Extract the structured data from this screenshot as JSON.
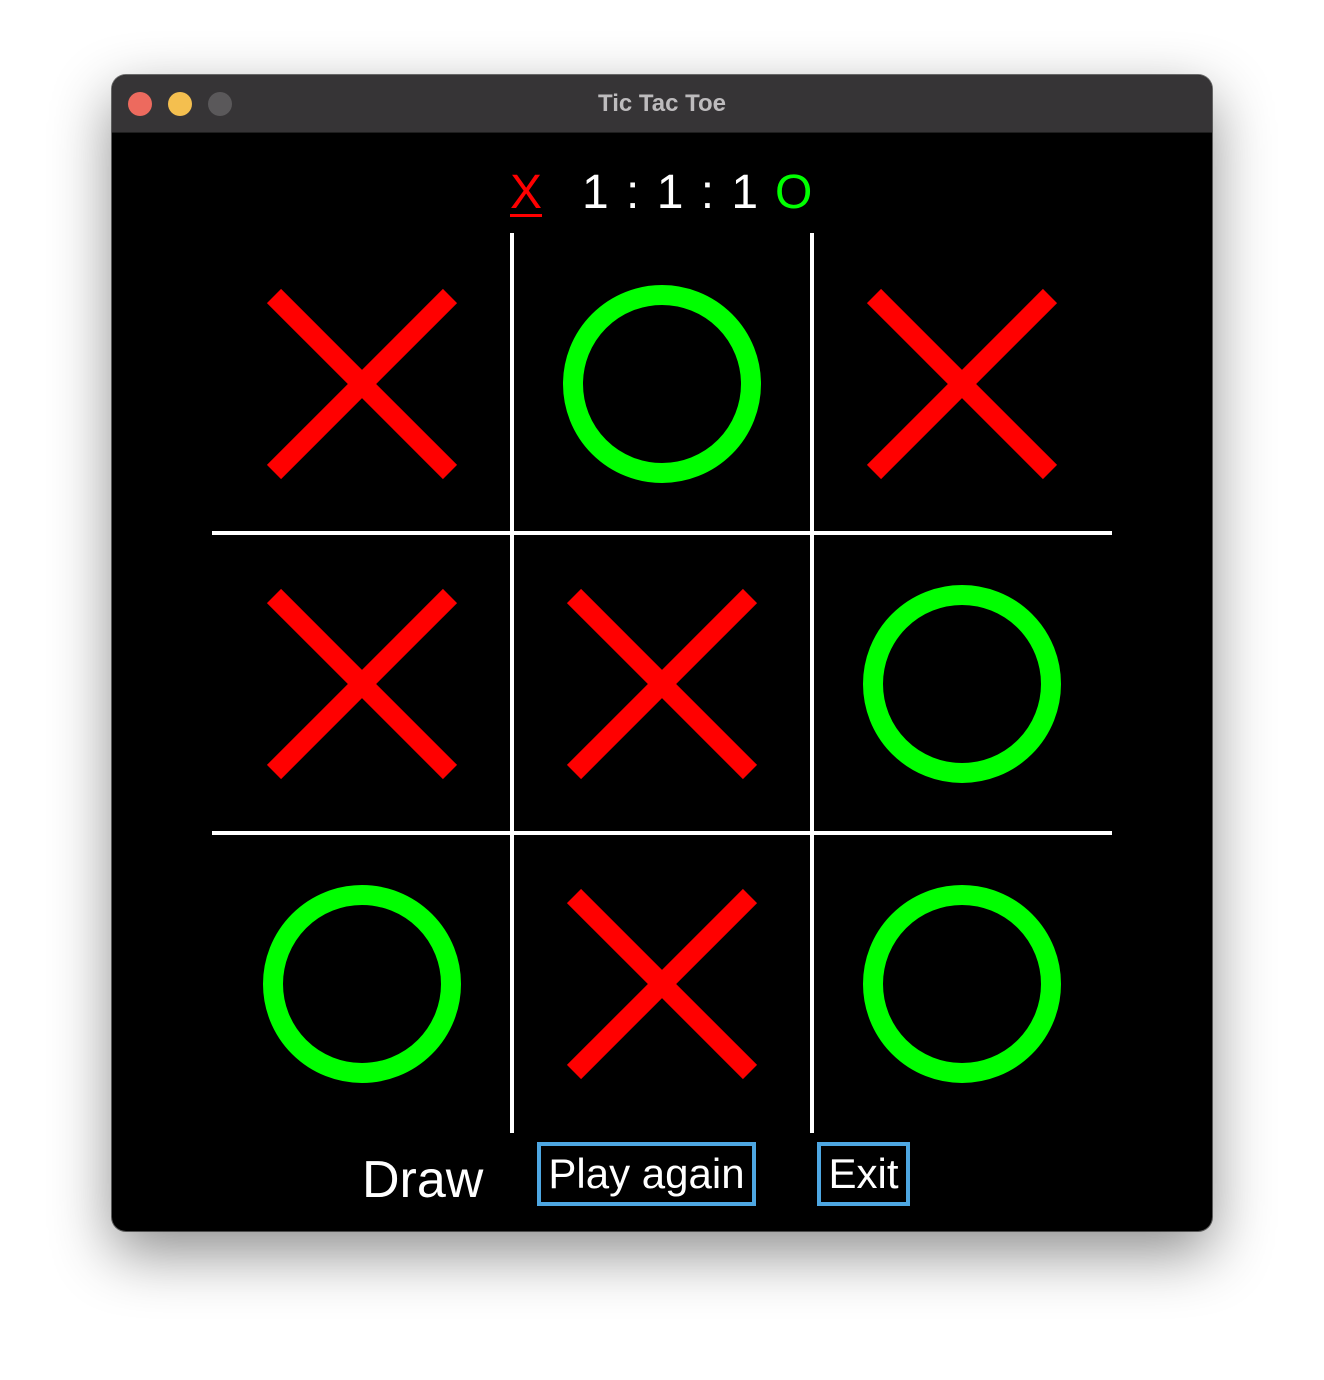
{
  "window": {
    "title": "Tic Tac Toe"
  },
  "score": {
    "x_label": "X",
    "text": "1 : 1 : 1",
    "o_label": "O",
    "current_turn": "X"
  },
  "board": {
    "cells": [
      [
        "X",
        "O",
        "X"
      ],
      [
        "X",
        "X",
        "O"
      ],
      [
        "O",
        "X",
        "O"
      ]
    ],
    "x_color": "#ff0000",
    "o_color": "#00ff00",
    "grid_color": "#ffffff"
  },
  "status": {
    "text": "Draw"
  },
  "buttons": {
    "play_again_label": "Play again",
    "exit_label": "Exit",
    "border_color": "#4ea7e2"
  }
}
